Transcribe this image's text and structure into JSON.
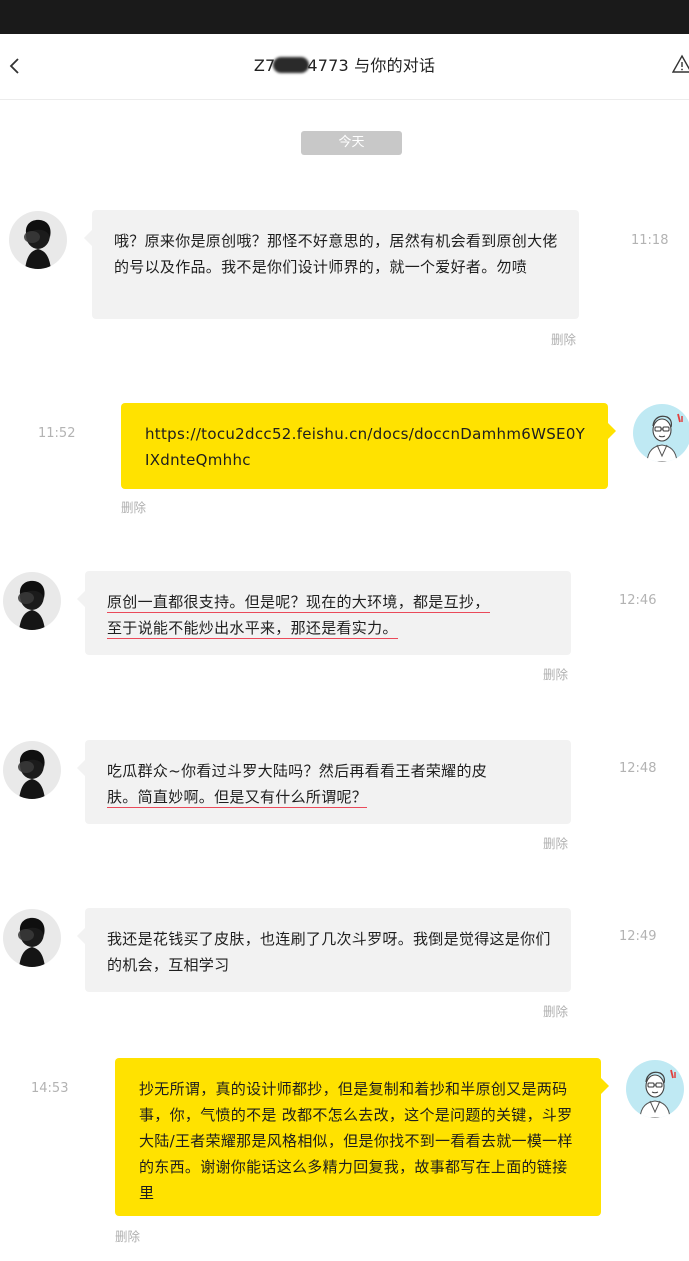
{
  "header": {
    "title_prefix": "Z7",
    "title_suffix": "4773 与你的对话"
  },
  "date_divider": "今天",
  "messages": [
    {
      "side": "incoming",
      "time": "11:18",
      "text": "哦？原来你是原创哦？那怪不好意思的，居然有机会看到原创大佬的号以及作品。我不是你们设计师界的，就一个爱好者。勿喷",
      "delete_label": "删除"
    },
    {
      "side": "outgoing",
      "time": "11:52",
      "text": "https://tocu2dcc52.feishu.cn/docs/doccnDamhm6WSE0YIXdnteQmhhc",
      "delete_label": "删除"
    },
    {
      "side": "incoming",
      "time": "12:46",
      "line1": "原创一直都很支持。但是呢？现在的大环境，都是互抄，",
      "line2": "至于说能不能炒出水平来，那还是看实力。",
      "delete_label": "删除"
    },
    {
      "side": "incoming",
      "time": "12:48",
      "line1": "吃瓜群众~你看过斗罗大陆吗？然后再看看王者荣耀的皮",
      "line2": "肤。简直妙啊。但是又有什么所谓呢？",
      "delete_label": "删除"
    },
    {
      "side": "incoming",
      "time": "12:49",
      "text": "我还是花钱买了皮肤，也连刷了几次斗罗呀。我倒是觉得这是你们的机会，互相学习",
      "delete_label": "删除"
    },
    {
      "side": "outgoing",
      "time": "14:53",
      "text": "抄无所谓，真的设计师都抄，但是复制和着抄和半原创又是两码事，你，气愤的不是 改都不怎么去改，这个是问题的关键，斗罗大陆/王者荣耀那是风格相似，但是你找不到一看看去就一模一样的东西。谢谢你能话这么多精力回复我，故事都写在上面的链接里",
      "delete_label": "删除"
    }
  ],
  "icons": {
    "back": "chevron-left-icon",
    "report": "warning-triangle-icon",
    "other_avatar": "silhouette-avatar",
    "self_avatar": "sketch-avatar"
  },
  "colors": {
    "outgoing_bubble": "#ffe200",
    "incoming_bubble": "#f2f2f2",
    "underline": "#ea4a5a",
    "self_avatar_bg": "#bfe9f3"
  }
}
